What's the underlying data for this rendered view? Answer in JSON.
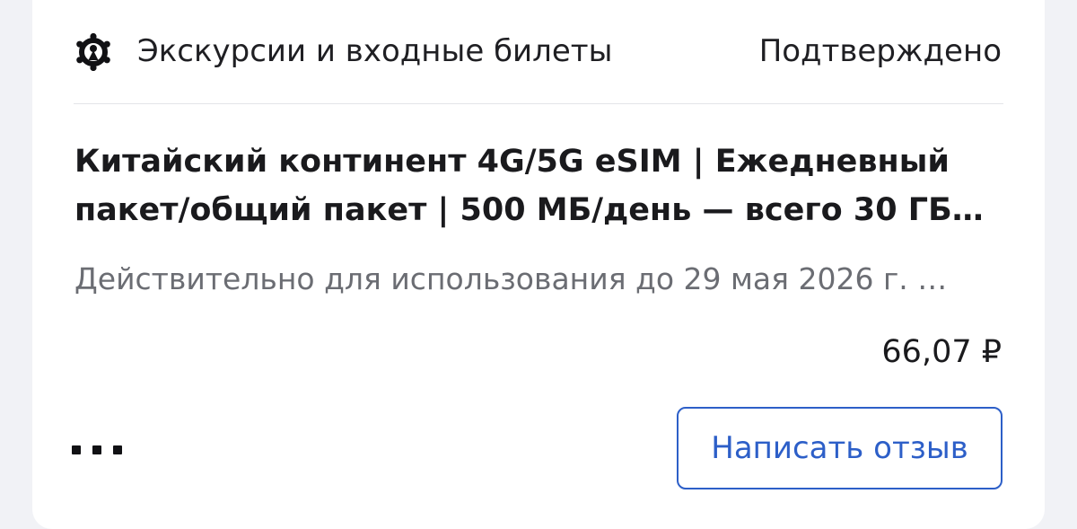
{
  "order_card": {
    "category": {
      "icon": "ferris-wheel-icon",
      "label": "Экскурсии и входные билеты"
    },
    "status": "Подтверждено",
    "product_title": "Китайский континент 4G/5G eSIM | Ежедневный пакет/общий пакет | 500 МБ/день — всего 30 ГБ…",
    "validity": "Действительно для использования до 29 мая 2026 г. (п…",
    "price": "66,07 ₽",
    "more_menu_icon": "more-dots-icon",
    "review_button_label": "Написать отзыв"
  },
  "colors": {
    "background": "#f1f2f6",
    "card": "#ffffff",
    "text_primary": "#1a1a1d",
    "text_secondary": "#6b6d73",
    "accent": "#2d5fc8",
    "divider": "#e3e4e8"
  }
}
